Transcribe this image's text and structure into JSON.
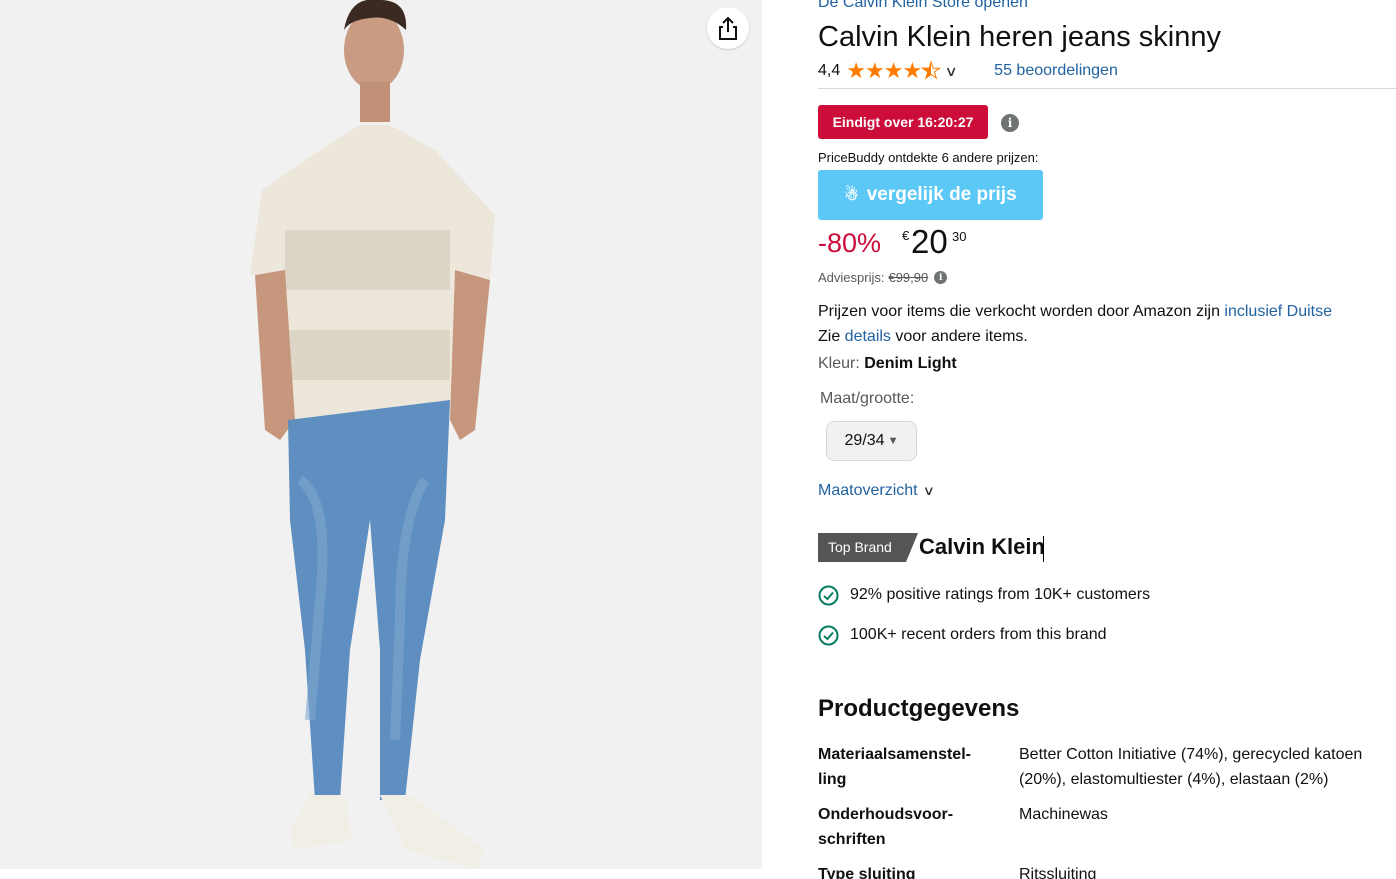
{
  "product": {
    "store_link": "De Calvin Klein Store openen",
    "title": "Calvin Klein heren jeans skinny",
    "rating_value": "4,4",
    "rating_stars": 4.4,
    "review_count": "55 beoordelingen"
  },
  "deal": {
    "badge": "Eindigt over 16:20:27",
    "pricebuddy_note": "PriceBuddy ontdekte 6 andere prijzen:",
    "compare_button": "vergelijk de prijs"
  },
  "price": {
    "discount": "-80%",
    "currency": "€",
    "whole": "20",
    "fraction": "30",
    "list_label": "Adviesprijs:",
    "list_value": "€99,90"
  },
  "tax": {
    "line1_pre": "Prijzen voor items die verkocht worden door Amazon zijn ",
    "line1_link": "inclusief Duitse",
    "line2_pre": "Zie ",
    "line2_link": "details",
    "line2_post": " voor andere items."
  },
  "variation": {
    "colour_label": "Kleur:",
    "colour_value": "Denim Light",
    "size_label": "Maat/grootte:",
    "size_value": "29/34",
    "size_chart_link": "Maatoverzicht"
  },
  "brand": {
    "badge": "Top Brand",
    "name": "Calvin Klein",
    "facts": [
      "92% positive ratings from 10K+ customers",
      "100K+ recent orders from this brand"
    ]
  },
  "details": {
    "title": "Productgegevens",
    "rows": [
      {
        "key": "Materiaalsamenstel-ling",
        "value_line1": "Better Cotton Initiative (74%), gerecycled katoen",
        "value_line2": "(20%), elastomultiester (4%), elastaan (2%)"
      },
      {
        "key": "Onderhoudsvoor-schriften",
        "value_line1": "Machinewas",
        "value_line2": ""
      },
      {
        "key": "Type sluiting",
        "value_line1": "Ritssluiting",
        "value_line2": ""
      }
    ]
  },
  "colors": {
    "link": "#2162a1",
    "deal_red": "#cc0c39",
    "star_orange": "#ff7b00",
    "compare_blue": "#5bc8f5",
    "check_green": "#067d62"
  }
}
